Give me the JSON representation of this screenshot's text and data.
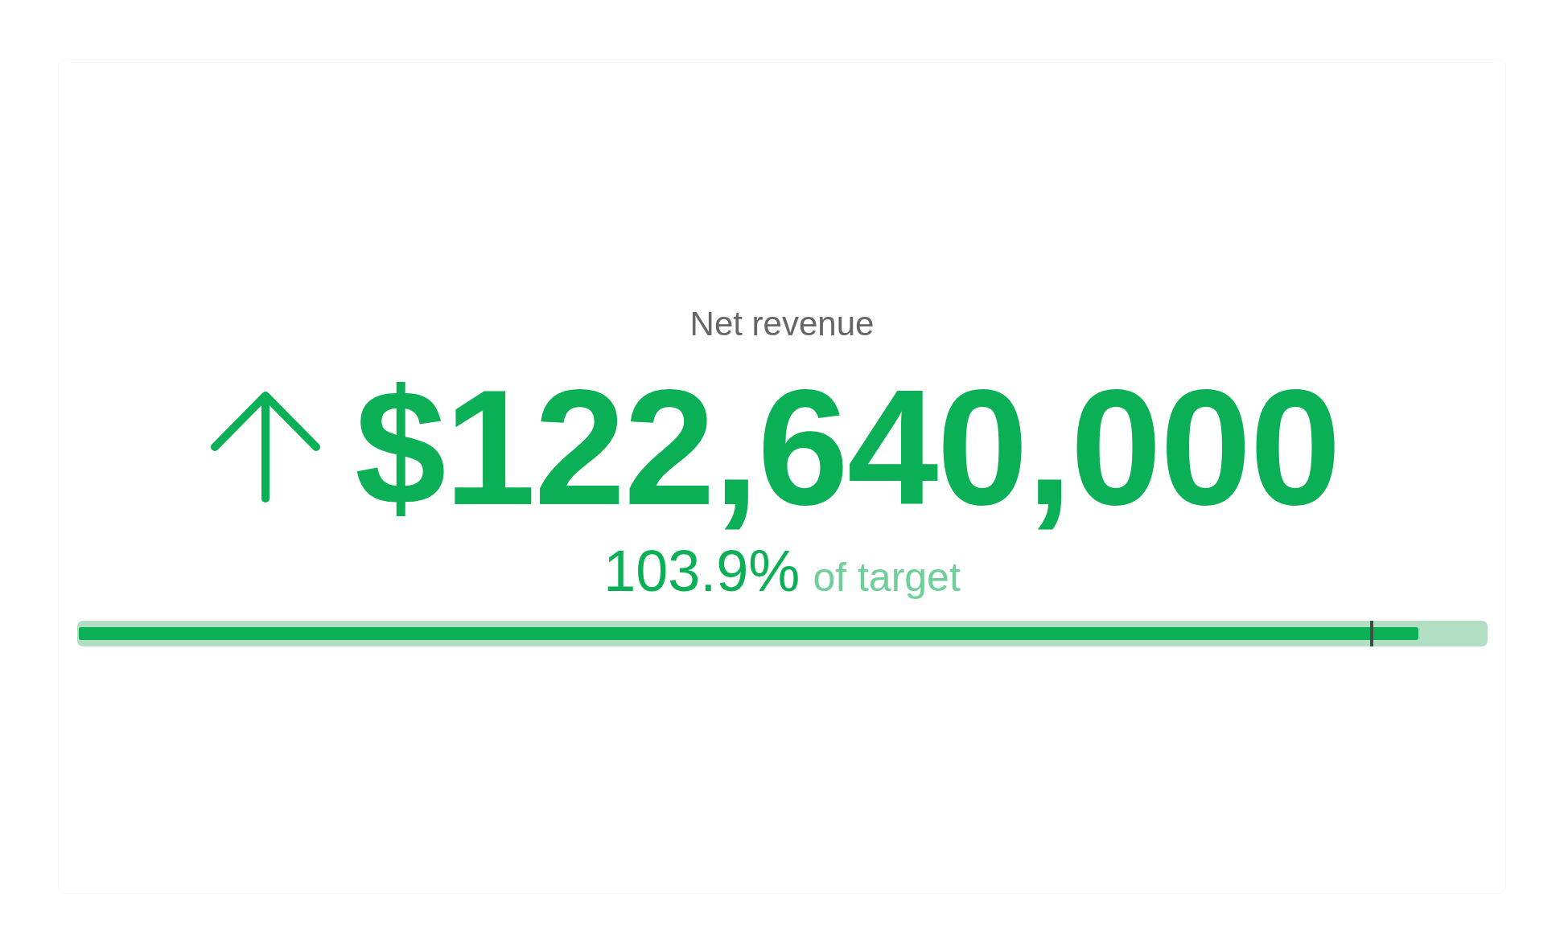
{
  "kpi": {
    "title": "Net revenue",
    "increasing": true,
    "value": "$122,640,000",
    "percent": "103.9%",
    "percent_caption": "of target",
    "progress": {
      "level": 0.951
    },
    "target_marker": {
      "level": 0.917
    }
  }
}
